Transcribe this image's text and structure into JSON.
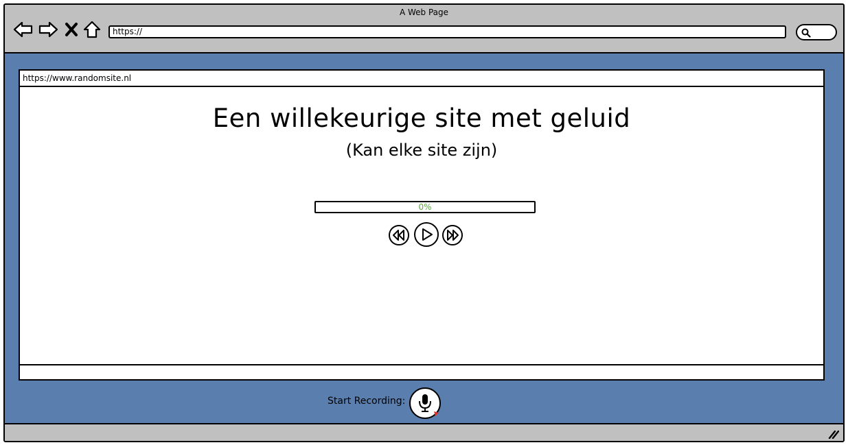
{
  "window": {
    "title": "A Web Page"
  },
  "toolbar": {
    "icons": [
      "back-icon",
      "forward-icon",
      "stop-icon",
      "home-icon",
      "search-icon"
    ],
    "address_value": "https://"
  },
  "page": {
    "url": "https://www.randomsite.nl",
    "heading": "Een willekeurige site met geluid",
    "subheading": "(Kan elke site zijn)"
  },
  "player": {
    "progress": 0,
    "progress_label": "0%",
    "controls": [
      "rewind-icon",
      "play-icon",
      "fast-forward-icon"
    ]
  },
  "recording": {
    "label": "Start Recording:",
    "icon": "microphone-icon",
    "indicator_color": "#e03030"
  },
  "colors": {
    "chrome": "#c0c0c0",
    "background": "#5a7ead",
    "progress_text": "#5aa83f"
  }
}
